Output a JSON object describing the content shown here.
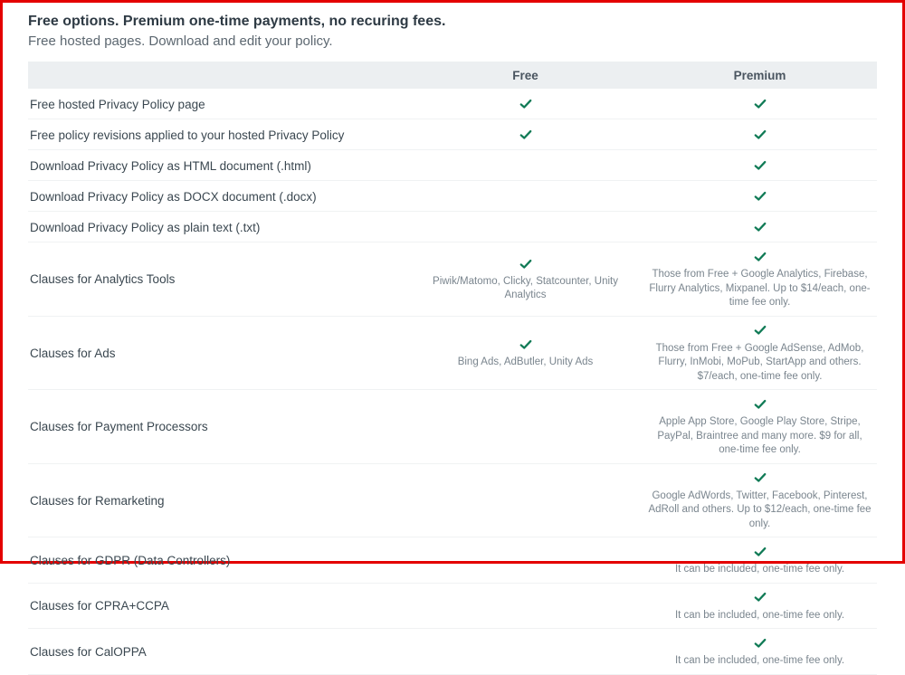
{
  "header": {
    "title": "Free options. Premium one-time payments, no recuring fees.",
    "subtitle": "Free hosted pages. Download and edit your policy."
  },
  "columns": {
    "free": "Free",
    "premium": "Premium"
  },
  "rows": [
    {
      "feature": "Free hosted Privacy Policy page",
      "free_check": true,
      "free_desc": "",
      "premium_check": true,
      "premium_desc": ""
    },
    {
      "feature": "Free policy revisions applied to your hosted Privacy Policy",
      "free_check": true,
      "free_desc": "",
      "premium_check": true,
      "premium_desc": ""
    },
    {
      "feature": "Download Privacy Policy as HTML document (.html)",
      "free_check": false,
      "free_desc": "",
      "premium_check": true,
      "premium_desc": ""
    },
    {
      "feature": "Download Privacy Policy as DOCX document (.docx)",
      "free_check": false,
      "free_desc": "",
      "premium_check": true,
      "premium_desc": ""
    },
    {
      "feature": "Download Privacy Policy as plain text (.txt)",
      "free_check": false,
      "free_desc": "",
      "premium_check": true,
      "premium_desc": ""
    },
    {
      "feature": "Clauses for Analytics Tools",
      "free_check": true,
      "free_desc": "Piwik/Matomo, Clicky, Statcounter, Unity Analytics",
      "premium_check": true,
      "premium_desc": "Those from Free + Google Analytics, Firebase, Flurry Analytics, Mixpanel. Up to $14/each, one-time fee only."
    },
    {
      "feature": "Clauses for Ads",
      "free_check": true,
      "free_desc": "Bing Ads, AdButler, Unity Ads",
      "premium_check": true,
      "premium_desc": "Those from Free + Google AdSense, AdMob, Flurry, InMobi, MoPub, StartApp and others. $7/each, one-time fee only."
    },
    {
      "feature": "Clauses for Payment Processors",
      "free_check": false,
      "free_desc": "",
      "premium_check": true,
      "premium_desc": "Apple App Store, Google Play Store, Stripe, PayPal, Braintree and many more. $9 for all, one-time fee only."
    },
    {
      "feature": "Clauses for Remarketing",
      "free_check": false,
      "free_desc": "",
      "premium_check": true,
      "premium_desc": "Google AdWords, Twitter, Facebook, Pinterest, AdRoll and others. Up to $12/each, one-time fee only."
    },
    {
      "feature": "Clauses for GDPR (Data Controllers)",
      "free_check": false,
      "free_desc": "",
      "premium_check": true,
      "premium_desc": "It can be included, one-time fee only."
    },
    {
      "feature": "Clauses for CPRA+CCPA",
      "free_check": false,
      "free_desc": "",
      "premium_check": true,
      "premium_desc": "It can be included, one-time fee only."
    },
    {
      "feature": "Clauses for CalOPPA",
      "free_check": false,
      "free_desc": "",
      "premium_check": true,
      "premium_desc": "It can be included, one-time fee only."
    }
  ],
  "colors": {
    "check": "#0f7a55"
  }
}
